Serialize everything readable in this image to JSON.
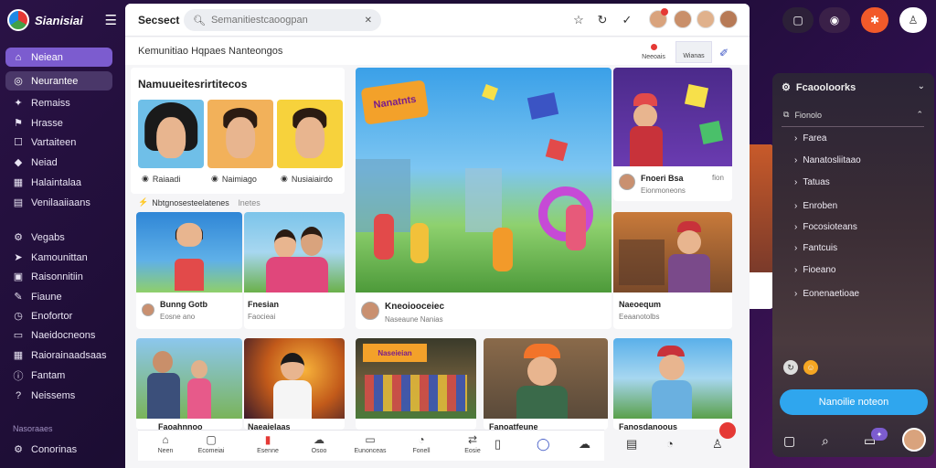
{
  "brand": {
    "name": "Sianisiai"
  },
  "sidebar": {
    "items": [
      {
        "label": "Neiean",
        "icon": "home-icon"
      },
      {
        "label": "Neurantee",
        "icon": "compass-icon"
      },
      {
        "label": "Remaiss",
        "icon": "sparkle-icon"
      },
      {
        "label": "Hrasse",
        "icon": "flag-icon"
      },
      {
        "label": "Vartaiteen",
        "icon": "square-icon"
      },
      {
        "label": "Neiad",
        "icon": "diamond-icon"
      },
      {
        "label": "Halaintalaa",
        "icon": "grid-icon"
      },
      {
        "label": "Venilaaiiaans",
        "icon": "list-icon"
      },
      {
        "label": "Vegabs",
        "icon": "gear-icon"
      },
      {
        "label": "Kamounittan",
        "icon": "send-icon"
      },
      {
        "label": "Raisonnitiin",
        "icon": "film-icon"
      },
      {
        "label": "Fiaune",
        "icon": "pen-icon"
      },
      {
        "label": "Enofortor",
        "icon": "clock-icon"
      },
      {
        "label": "Naeidocneons",
        "icon": "chat-icon"
      },
      {
        "label": "Raiorainaadsaas",
        "icon": "grid-icon"
      },
      {
        "label": "Fantam",
        "icon": "info-icon"
      },
      {
        "label": "Neissems",
        "icon": "help-icon"
      }
    ],
    "section_label": "Nasoraaes",
    "footer_item": {
      "label": "Conorinas",
      "icon": "settings-icon"
    }
  },
  "topbar": {
    "title": "Secsect",
    "search_placeholder": "Semanitiestcaoogpan"
  },
  "subbar": {
    "label": "Kemunitiao  Hqpaes Nanteongos",
    "tabs": [
      "Neeoais",
      "Wianas"
    ]
  },
  "section_community": {
    "title": "Namuueitesrirtitecos",
    "people": [
      {
        "name": "Raiaadi"
      },
      {
        "name": "Naimiago"
      },
      {
        "name": "Nusiaiairdo"
      }
    ]
  },
  "section_live": {
    "label": "Nbtgnosesteelatenes",
    "tag": "lnetes",
    "cards": [
      {
        "title": "Bunng Gotb",
        "sub": "Eosne  ano"
      },
      {
        "title": "Fnesian",
        "sub": "Faocieai"
      }
    ]
  },
  "feature": {
    "title": "Kneoiooceiec",
    "sub": "Naseaune  Nanias"
  },
  "side_cards": [
    {
      "title": "Fnoeri Bsa",
      "sub": "Eionmoneons",
      "tag": "fion"
    },
    {
      "title": "Naeoequm",
      "sub": "Eeaanotolbs"
    }
  ],
  "bottom_row": [
    {
      "title": "Faoahnnoo"
    },
    {
      "title": "Naeaielaas"
    },
    {
      "title": "Naseieian"
    },
    {
      "title": "Fanoatfeune"
    },
    {
      "title": "Fanosdanoous"
    }
  ],
  "poster_text": "Nanatnts",
  "bottomnav": [
    "Neen",
    "Ecomeiai",
    "Esenne",
    "Osoo",
    "Eunonceas",
    "Fonell",
    "Eosie"
  ],
  "rightpanel": {
    "title": "Fcaooloorks",
    "filter": "Fionolo",
    "items": [
      "Farea",
      "Nanatosliitaao",
      "Tatuas",
      "Enroben",
      "Focosioteans",
      "Fantcuis",
      "Fioeano",
      "Eonenaetioae"
    ],
    "cta": "Nanoilie noteon"
  },
  "colors": {
    "accent": "#7c5ccf",
    "cta": "#2fa6ee",
    "badge": "#e53935"
  }
}
